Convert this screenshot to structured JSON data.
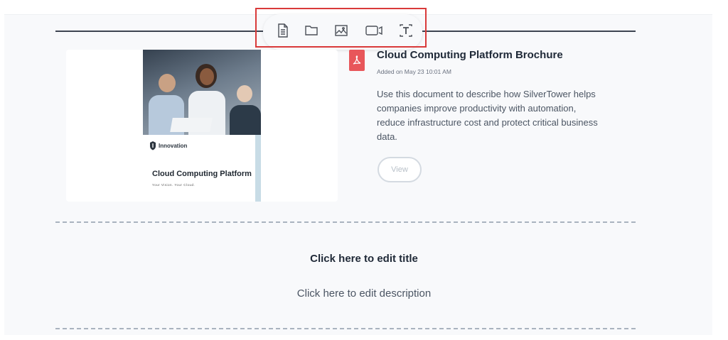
{
  "toolbar": {
    "items": [
      {
        "icon": "document-icon"
      },
      {
        "icon": "folder-icon"
      },
      {
        "icon": "image-icon"
      },
      {
        "icon": "video-icon"
      },
      {
        "icon": "text-icon"
      }
    ],
    "highlight_color": "#d93a3a"
  },
  "document_block": {
    "thumbnail": {
      "logo_text": "Innovation",
      "title": "Cloud Computing Platform",
      "tagline": "Your Vision. Your Cloud."
    },
    "file_icon": "pdf-icon",
    "title": "Cloud Computing Platform Brochure",
    "added": "Added on May 23 10:01 AM",
    "description": "Use this document to describe how SilverTower helps companies improve productivity with automation, reduce infrastructure cost and protect critical business data.",
    "view_label": "View"
  },
  "placeholder_block": {
    "title": "Click here to edit title",
    "description": "Click here to edit description"
  },
  "colors": {
    "accent_pdf": "#e8565a",
    "text_dark": "#1f2937",
    "text_muted": "#4b5563",
    "divider": "#3d4451"
  }
}
